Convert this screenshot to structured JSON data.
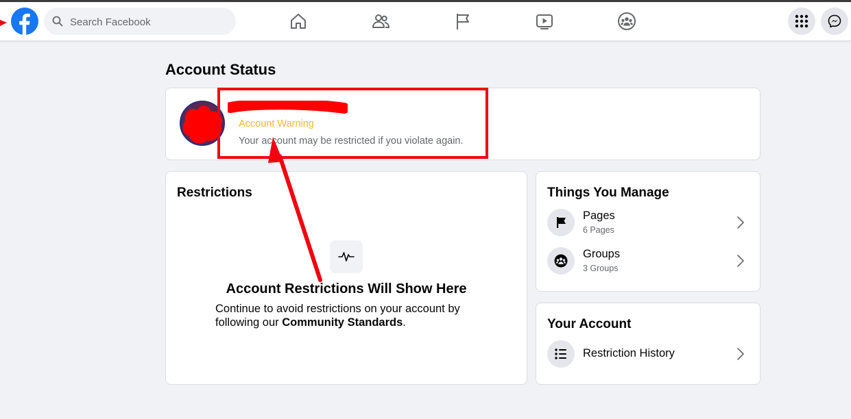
{
  "navbar": {
    "search_placeholder": "Search Facebook",
    "brand_color": "#1877f2"
  },
  "page": {
    "title": "Account Status"
  },
  "status": {
    "warning_title": "Account Warning",
    "warning_text": "Your account may be restricted if you violate again.",
    "warning_color": "#f7b928"
  },
  "restrictions": {
    "heading": "Restrictions",
    "empty_title": "Account Restrictions Will Show Here",
    "empty_desc": "Continue to avoid restrictions on your account by following our ",
    "link_text": "Community Standards",
    "period": "."
  },
  "manage": {
    "heading": "Things You Manage",
    "items": [
      {
        "title": "Pages",
        "subtitle": "6 Pages",
        "icon": "flag-icon"
      },
      {
        "title": "Groups",
        "subtitle": "3 Groups",
        "icon": "groups-icon"
      }
    ]
  },
  "account": {
    "heading": "Your Account",
    "items": [
      {
        "title": "Restriction History",
        "icon": "list-icon"
      }
    ]
  },
  "annotation_color": "#f2000f"
}
